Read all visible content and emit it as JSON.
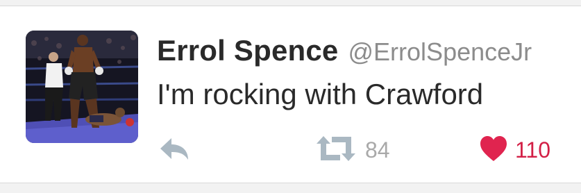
{
  "tweet": {
    "author_name": "Errol Spence",
    "author_handle": "@ErrolSpenceJr",
    "text": "I'm rocking with Crawford",
    "avatar": "boxing-ring-photo",
    "actions": {
      "reply_icon": "reply-icon",
      "retweet_icon": "retweet-icon",
      "retweet_count": "84",
      "like_icon": "heart-icon",
      "like_count": "110"
    }
  },
  "colors": {
    "name": "#2a2a2a",
    "handle": "#8c8c8c",
    "icon_gray": "#aab8c2",
    "like_red": "#e0244f",
    "like_count": "#d32046",
    "retweet_count": "#a9a9a9"
  }
}
